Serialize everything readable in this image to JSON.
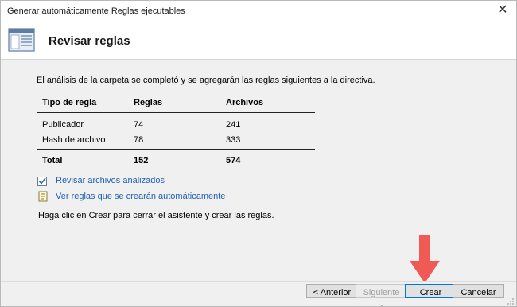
{
  "window": {
    "title": "Generar automáticamente Reglas ejecutables",
    "close_glyph": "✕"
  },
  "header": {
    "title": "Revisar reglas",
    "icon": "rules-window-icon"
  },
  "main": {
    "intro": "El análisis de la carpeta se completó y se agregarán las reglas siguientes a la directiva.",
    "table": {
      "headers": [
        "Tipo de regla",
        "Reglas",
        "Archivos"
      ],
      "rows": [
        [
          "Publicador",
          "74",
          "241"
        ],
        [
          "Hash de archivo",
          "78",
          "333"
        ]
      ],
      "total": [
        "Total",
        "152",
        "574"
      ]
    },
    "links": [
      {
        "label": "Revisar archivos analizados",
        "icon": "checkbox-list-icon"
      },
      {
        "label": "Ver reglas que se crearán automáticamente",
        "icon": "document-rules-icon"
      }
    ],
    "footer_text": "Haga clic en Crear para cerrar el asistente y crear las reglas."
  },
  "buttons": {
    "back": "< Anterior",
    "next": "Siguiente >",
    "create": "Crear",
    "cancel": "Cancelar"
  },
  "colors": {
    "link": "#1e5fb3",
    "arrow": "#f05a55",
    "accent_border": "#0078d7"
  }
}
